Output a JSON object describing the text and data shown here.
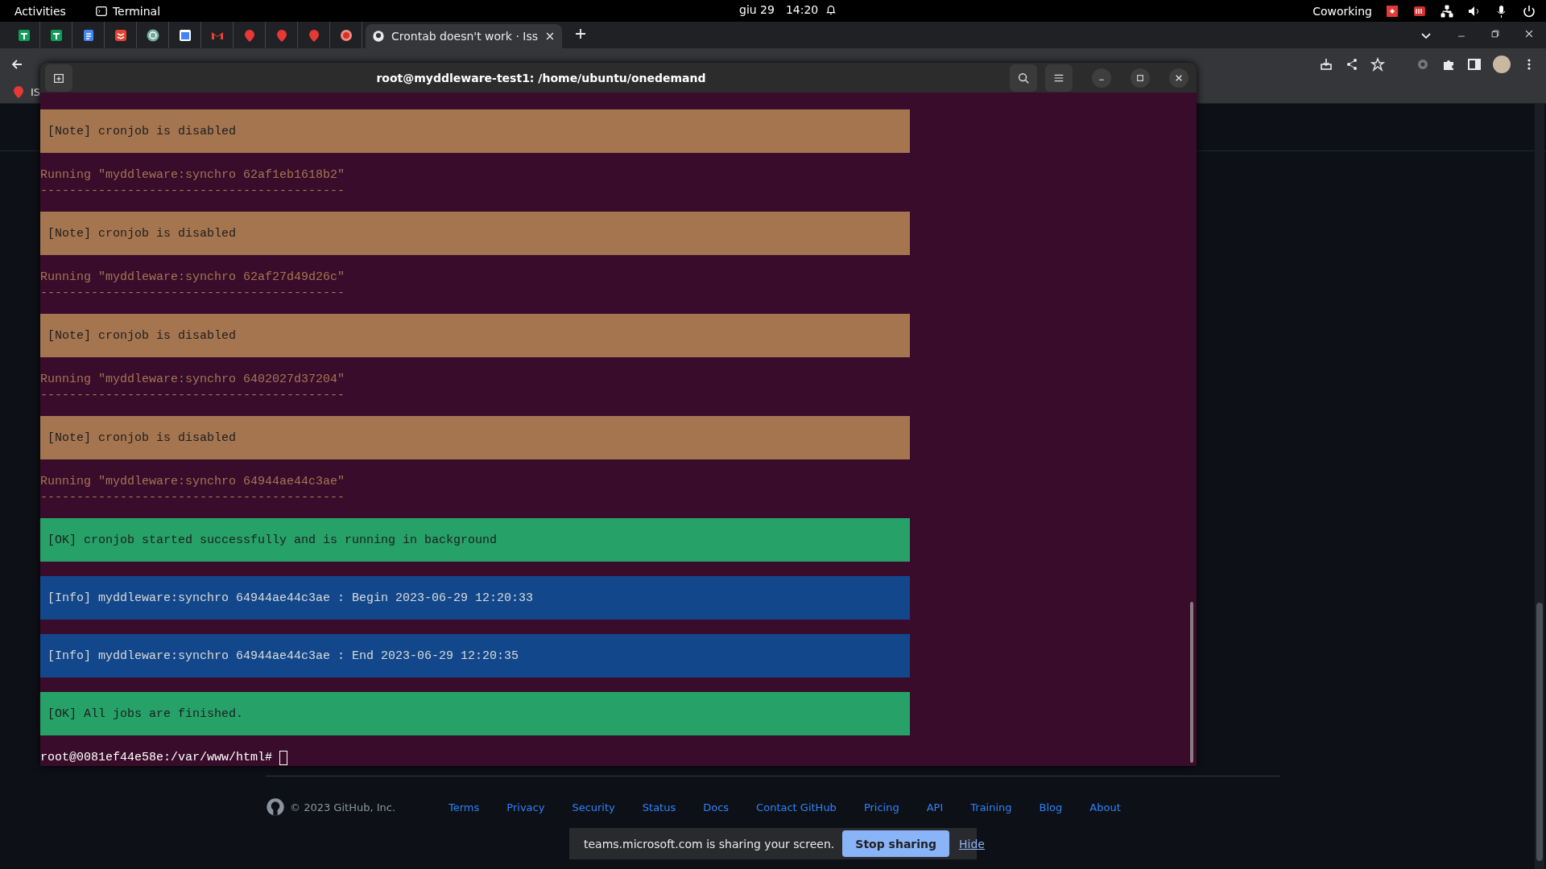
{
  "top_bar": {
    "activities": "Activities",
    "app": "Terminal",
    "date": "giu 29",
    "time": "14:20",
    "workspace": "Coworking"
  },
  "browser": {
    "active_tab": {
      "title": "Crontab doesn't work · Iss"
    },
    "bookmark": "IS"
  },
  "terminal": {
    "title": "root@myddleware-test1: /home/ubuntu/onedemand",
    "lines": [
      {
        "kind": "note",
        "text": "[Note] cronjob is disabled"
      },
      {
        "kind": "running",
        "text": "Running \"myddleware:synchro 62af1eb1618b2\"",
        "rule": "------------------------------------------"
      },
      {
        "kind": "note",
        "text": "[Note] cronjob is disabled"
      },
      {
        "kind": "running",
        "text": "Running \"myddleware:synchro 62af27d49d26c\"",
        "rule": "------------------------------------------"
      },
      {
        "kind": "note",
        "text": "[Note] cronjob is disabled"
      },
      {
        "kind": "running",
        "text": "Running \"myddleware:synchro 6402027d37204\"",
        "rule": "------------------------------------------"
      },
      {
        "kind": "note",
        "text": "[Note] cronjob is disabled"
      },
      {
        "kind": "running",
        "text": "Running \"myddleware:synchro 64944ae44c3ae\"",
        "rule": "------------------------------------------"
      },
      {
        "kind": "ok",
        "text": "[OK] cronjob started successfully and is running in background"
      },
      {
        "kind": "info",
        "text": "[Info] myddleware:synchro 64944ae44c3ae : Begin 2023-06-29 12:20:33"
      },
      {
        "kind": "info",
        "text": "[Info] myddleware:synchro 64944ae44c3ae : End 2023-06-29 12:20:35"
      },
      {
        "kind": "ok",
        "text": "[OK] All jobs are finished."
      }
    ],
    "prompt": "root@0081ef44e58e:/var/www/html#"
  },
  "footer": {
    "copyright": "© 2023 GitHub, Inc.",
    "links": [
      "Terms",
      "Privacy",
      "Security",
      "Status",
      "Docs",
      "Contact GitHub",
      "Pricing",
      "API",
      "Training",
      "Blog",
      "About"
    ]
  },
  "share_bar": {
    "message": "teams.microsoft.com is sharing your screen.",
    "stop": "Stop sharing",
    "hide": "Hide"
  }
}
